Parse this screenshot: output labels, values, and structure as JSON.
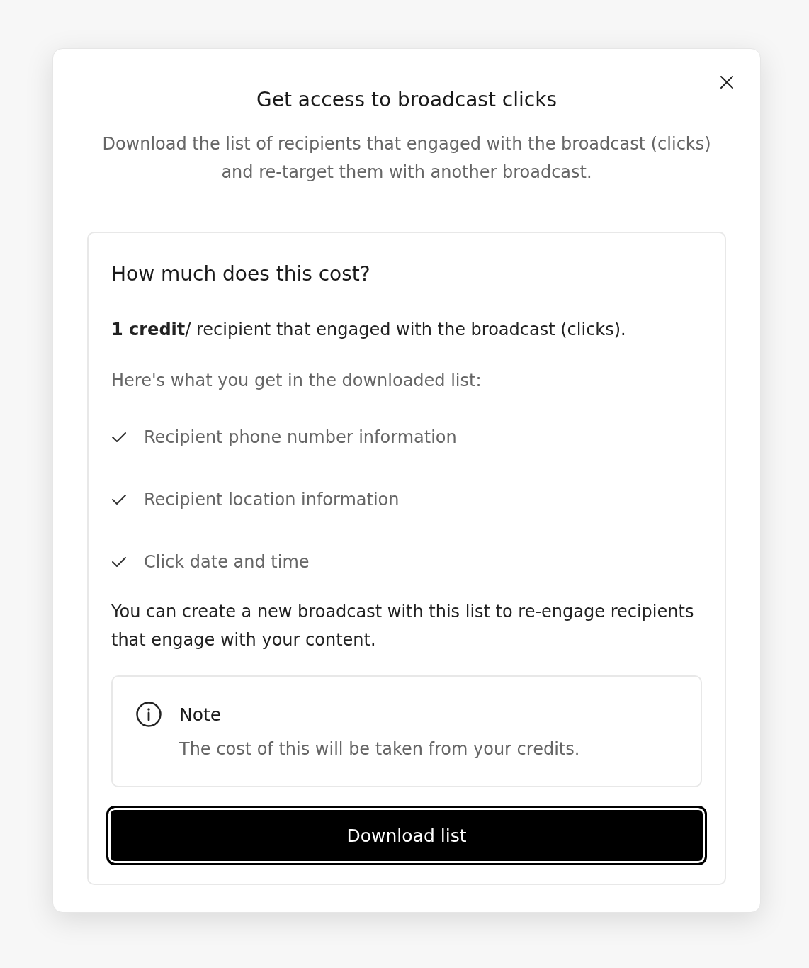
{
  "dialog": {
    "title": "Get access to broadcast clicks",
    "subtitle": "Download the list of recipients that engaged with the broadcast (clicks) and re-target them with another broadcast.",
    "card": {
      "heading": "How much does this cost?",
      "price": "**1 credit**/ recipient that engaged with the broadcast (clicks).",
      "intro": "Here's what you get in the downloaded list:",
      "features": [
        "Recipient phone number information",
        "Recipient location information",
        "Click date and time"
      ],
      "outro": "You can create a new broadcast with this list to re-engage recipients that engage with your content.",
      "note": {
        "title": "Note",
        "text": "The cost of this will be taken from your credits."
      },
      "button": "Download list"
    }
  }
}
